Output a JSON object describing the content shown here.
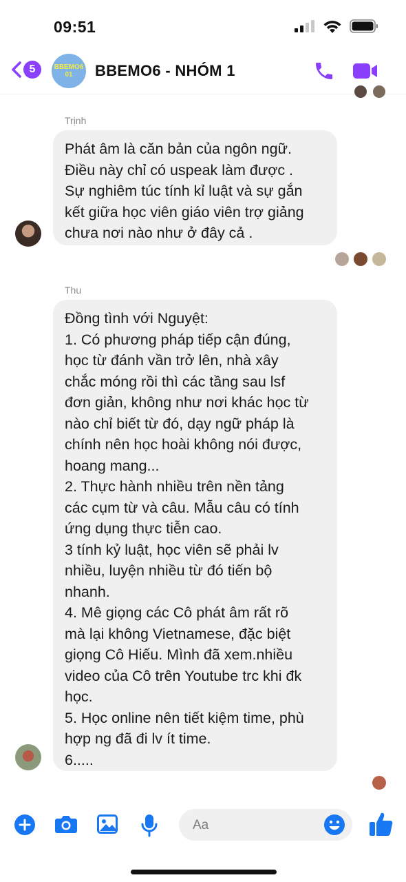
{
  "status_bar": {
    "time": "09:51"
  },
  "header": {
    "back_count": "5",
    "group_avatar_text": [
      "BBEMO6",
      "01"
    ],
    "title": "BBEMO6 - NHÓM 1"
  },
  "messages": [
    {
      "sender": "Trịnh",
      "lines": [
        "Phát âm  là căn bản của ngôn ngữ.",
        "Điều này chỉ có uspeak làm được .",
        "Sự nghiêm túc tính kỉ luật và sự gắn",
        "kết giữa học viên giáo viên trợ giảng",
        "chưa nơi nào như ở đây cả ."
      ]
    },
    {
      "sender": "Thu",
      "lines": [
        "Đồng tình với Nguyệt:",
        "1. Có phương pháp tiếp cận đúng,",
        "học từ đánh vần trở lên, nhà xây",
        "chắc móng rồi thì các tầng sau lsf",
        "đơn giản, không như nơi khác học từ",
        "nào chỉ biết từ đó, dạy ngữ pháp là",
        "chính nên học hoài không nói được,",
        "hoang mang...",
        "2. Thực hành nhiều trên nền tảng",
        "các cụm từ và câu. Mẫu câu có tính",
        "ứng dụng thực tiễn cao.",
        "3 tính kỷ luật, học viên sẽ phải lv",
        "nhiều, luyện nhiều từ đó tiến bộ",
        "nhanh.",
        "4. Mê giọng các Cô phát âm rất rõ",
        "mà lại không Vietnamese, đặc biệt",
        "giọng Cô Hiếu. Mình đã xem.nhiều",
        "video của Cô trên Youtube trc khi đk",
        "học.",
        "5. Học online nên tiết kiệm time, phù",
        "hợp ng đã đi lv ít time.",
        "6....."
      ]
    }
  ],
  "composer": {
    "placeholder": "Aa"
  },
  "colors": {
    "accent": "#8a3ffc",
    "messenger_blue": "#1877f2",
    "bubble": "#f0f0f0"
  }
}
